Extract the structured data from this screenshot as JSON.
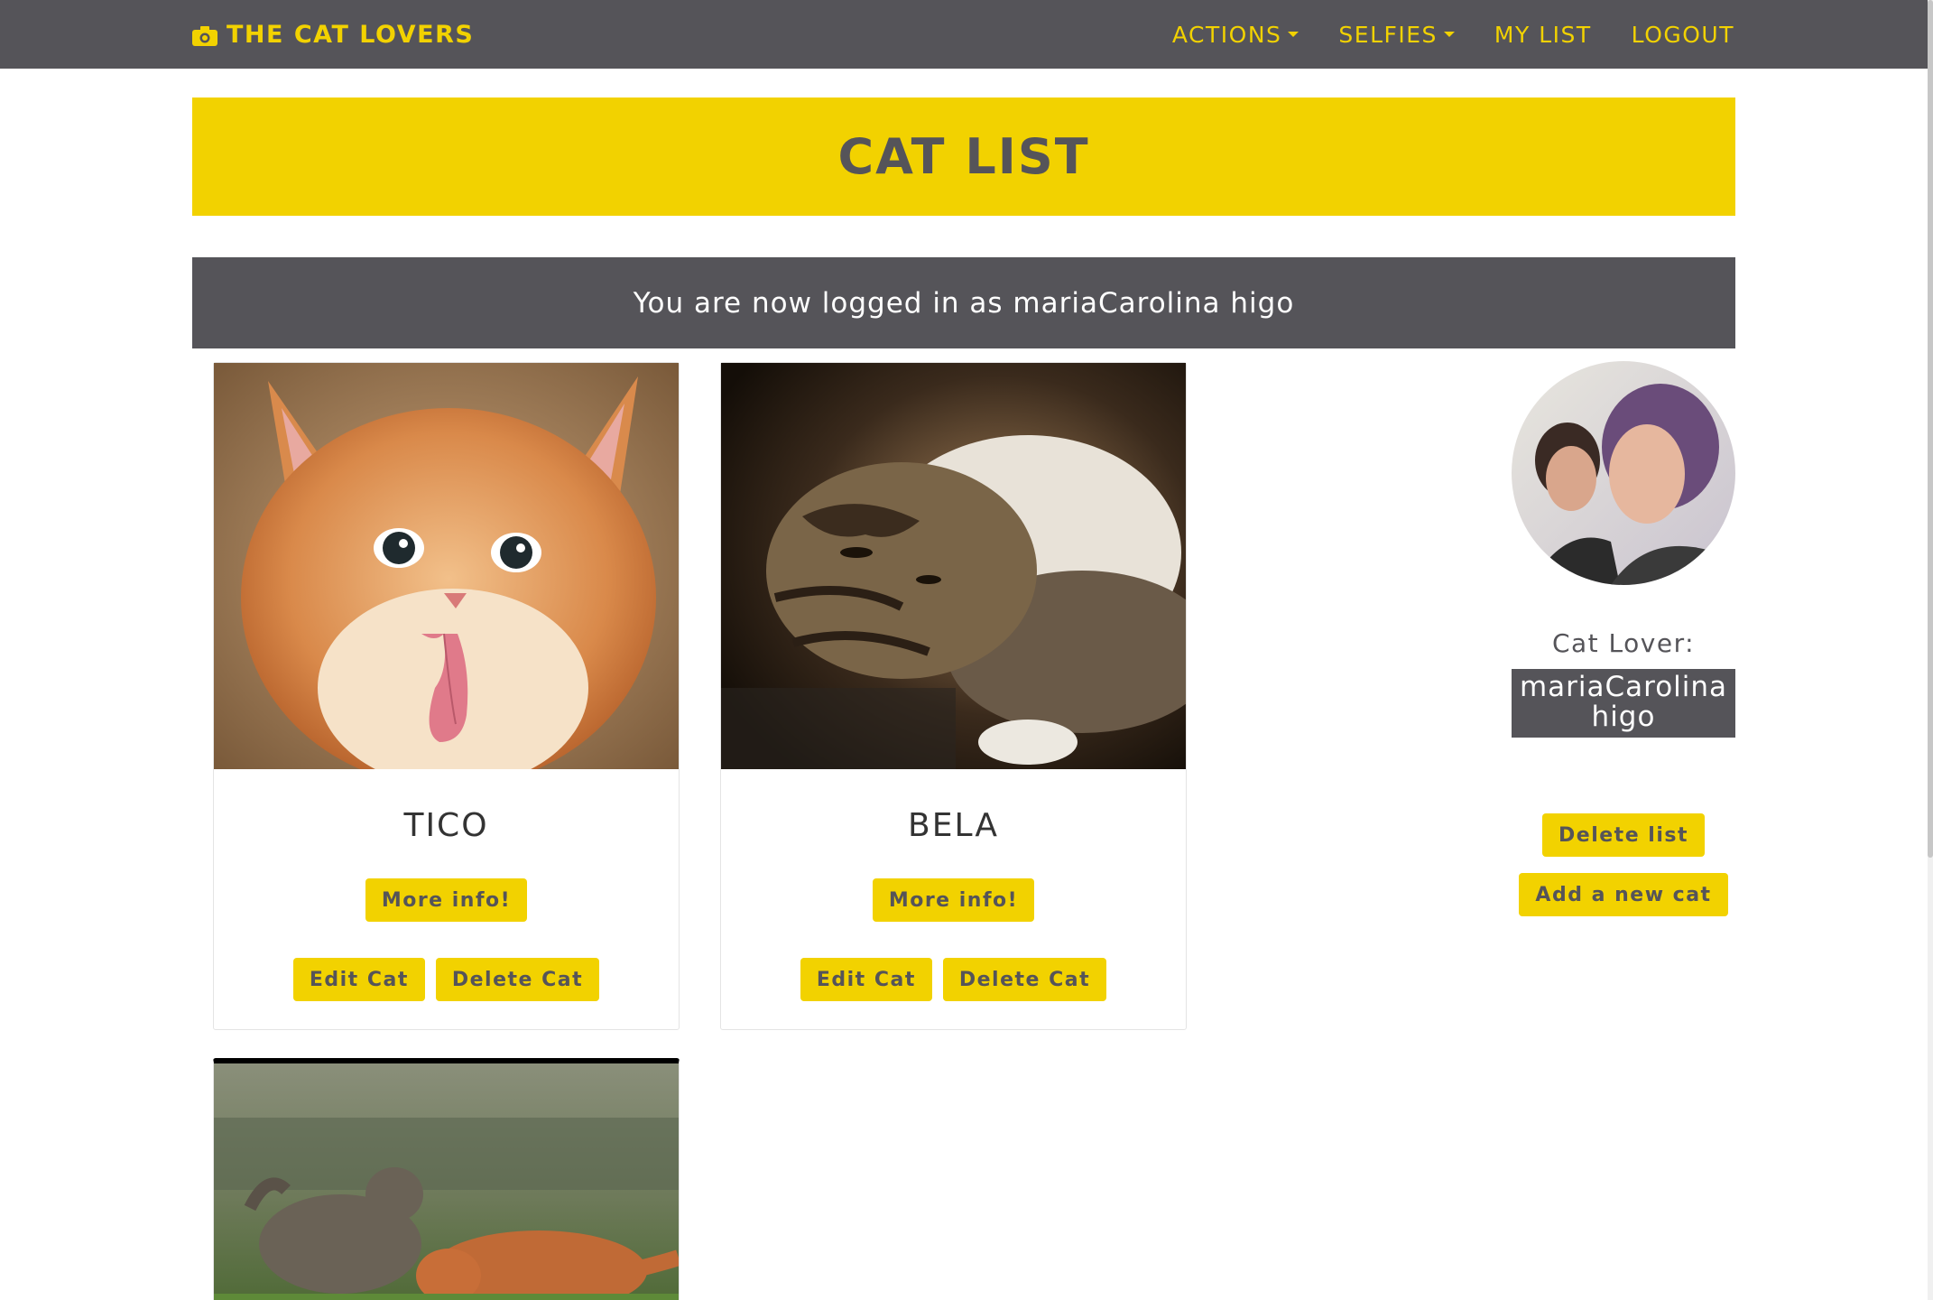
{
  "navbar": {
    "brand": "THE CAT LOVERS",
    "brand_icon": "camera-icon",
    "links": [
      {
        "label": "ACTIONS",
        "dropdown": true
      },
      {
        "label": "SELFIES",
        "dropdown": true
      },
      {
        "label": "MY LIST",
        "dropdown": false
      },
      {
        "label": "LOGOUT",
        "dropdown": false
      }
    ]
  },
  "banner": {
    "title": "CAT LIST"
  },
  "flash": {
    "message": "You are now logged in as mariaCarolina higo"
  },
  "cats": [
    {
      "name": "TICO",
      "more_label": "More info!",
      "edit_label": "Edit Cat",
      "delete_label": "Delete Cat",
      "photo": "orange-kitten-photo"
    },
    {
      "name": "BELA",
      "more_label": "More info!",
      "edit_label": "Edit Cat",
      "delete_label": "Delete Cat",
      "photo": "tabby-cat-photo"
    },
    {
      "name": "",
      "photo": "two-cats-fighting-photo"
    }
  ],
  "profile": {
    "label": "Cat Lover:",
    "name": "mariaCarolina higo",
    "delete_list_label": "Delete list",
    "add_cat_label": "Add a new cat"
  },
  "colors": {
    "accent": "#f2d200",
    "dark": "#555459",
    "white": "#ffffff"
  }
}
